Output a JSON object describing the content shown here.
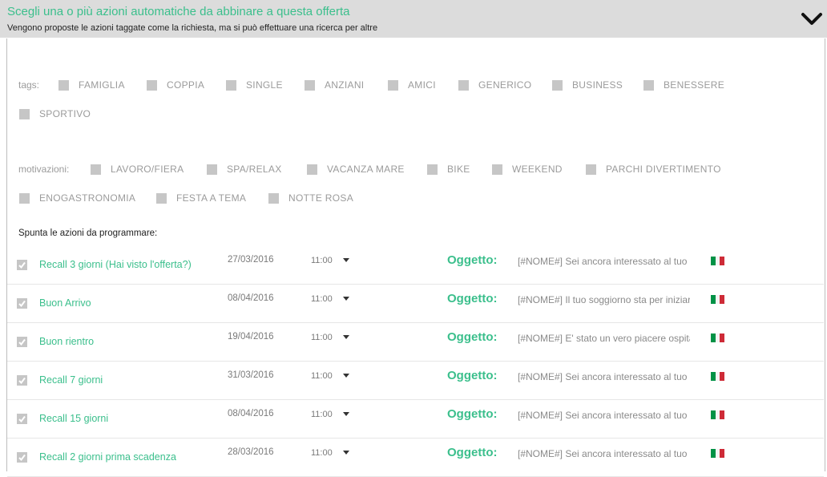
{
  "header": {
    "title": "Scegli una o più azioni automatiche da abbinare a questa offerta",
    "subtitle": "Vengono proposte le azioni taggate come la richiesta, ma si può effettuare una ricerca per altre",
    "toggle_icon": "chevron-down-icon"
  },
  "tags": {
    "label": "tags:",
    "options": [
      "FAMIGLIA",
      "COPPIA",
      "SINGLE",
      "ANZIANI",
      "AMICI",
      "GENERICO",
      "BUSINESS",
      "BENESSERE",
      "SPORTIVO"
    ]
  },
  "motivazioni": {
    "label": "motivazioni:",
    "options": [
      "LAVORO/FIERA",
      "SPA/RELAX",
      "VACANZA MARE",
      "BIKE",
      "WEEKEND",
      "PARCHI DIVERTIMENTO",
      "ENOGASTRONOMIA",
      "FESTA A TEMA",
      "NOTTE ROSA"
    ]
  },
  "actions_instruction": "Spunta le azioni da programmare:",
  "actions": [
    {
      "name": "Recall 3 giorni (Hai visto l'offerta?)",
      "date": "27/03/2016",
      "time": "11:00",
      "oggetto_label": "Oggetto:",
      "subject": "[#NOME#] Sei ancora interessato al tuo",
      "checked": true
    },
    {
      "name": "Buon Arrivo",
      "date": "08/04/2016",
      "time": "11:00",
      "oggetto_label": "Oggetto:",
      "subject": "[#NOME#] Il tuo soggiorno sta per iniziare",
      "checked": true
    },
    {
      "name": "Buon rientro",
      "date": "19/04/2016",
      "time": "11:00",
      "oggetto_label": "Oggetto:",
      "subject": "[#NOME#] E' stato un vero piacere ospitarti",
      "checked": true
    },
    {
      "name": "Recall 7 giorni",
      "date": "31/03/2016",
      "time": "11:00",
      "oggetto_label": "Oggetto:",
      "subject": "[#NOME#] Sei ancora interessato al tuo",
      "checked": true
    },
    {
      "name": "Recall 15 giorni",
      "date": "08/04/2016",
      "time": "11:00",
      "oggetto_label": "Oggetto:",
      "subject": "[#NOME#] Sei ancora interessato al tuo",
      "checked": true
    },
    {
      "name": "Recall 2 giorni prima scadenza",
      "date": "28/03/2016",
      "time": "11:00",
      "oggetto_label": "Oggetto:",
      "subject": "[#NOME#] Sei ancora interessato al tuo",
      "checked": true
    }
  ],
  "colors": {
    "accent": "#3bbf8c",
    "header_bg": "#dcdcdc",
    "checkbox": "#c6c6c6",
    "flag": [
      "#009246",
      "#ffffff",
      "#ce2b37"
    ]
  },
  "language_flag_icon": "italy-flag-icon"
}
